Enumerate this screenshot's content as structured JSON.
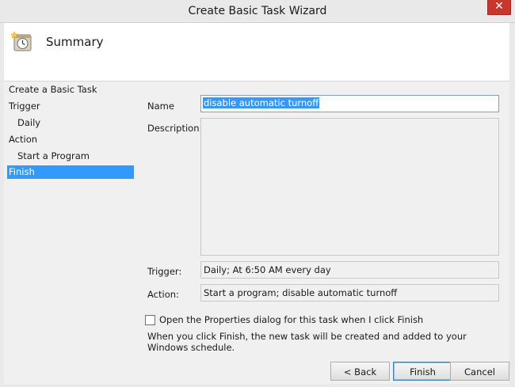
{
  "window": {
    "title": "Create Basic Task Wizard",
    "close_glyph": "✕"
  },
  "header": {
    "title": "Summary",
    "icon": "task-scheduler-clock-icon"
  },
  "sidebar": {
    "items": [
      {
        "label": "Create a Basic Task"
      },
      {
        "label": "Trigger"
      },
      {
        "label": "Daily"
      },
      {
        "label": "Action"
      },
      {
        "label": "Start a Program"
      },
      {
        "label": "Finish"
      }
    ],
    "active": "Finish"
  },
  "form": {
    "name_label": "Name",
    "name_value": "disable automatic turnoff",
    "description_label": "Description:",
    "description_value": "",
    "trigger_label": "Trigger:",
    "trigger_value": "Daily; At 6:50 AM every day",
    "action_label": "Action:",
    "action_value": "Start a program; disable automatic turnoff",
    "open_properties_label": "Open the Properties dialog for this task when I click Finish",
    "open_properties_checked": false,
    "info_text": "When you click Finish, the new task will be created and added to your Windows schedule."
  },
  "buttons": {
    "back": "< Back",
    "finish": "Finish",
    "cancel": "Cancel"
  },
  "colors": {
    "accent": "#3399ff",
    "close": "#c7372d",
    "panel": "#f0f0f0"
  }
}
